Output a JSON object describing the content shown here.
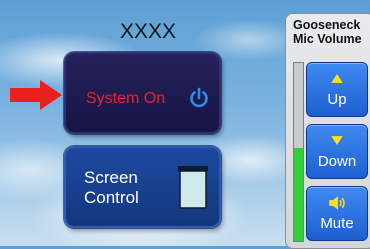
{
  "header": {
    "title": "XXXX"
  },
  "indicator": {
    "icon": "red-arrow-icon",
    "color": "#e8201e"
  },
  "tiles": {
    "system_on": {
      "label": "System On",
      "icon": "power-icon",
      "label_color": "#e8252d",
      "icon_color": "#2f8ce6"
    },
    "screen_control": {
      "label_line1": "Screen",
      "label_line2": "Control",
      "icon": "projector-screen-icon"
    }
  },
  "volume_panel": {
    "title_line1": "Gooseneck",
    "title_line2": "Mic Volume",
    "level": 0.52,
    "meter_color": "#34d03a",
    "buttons": {
      "up": {
        "label": "Up",
        "icon": "triangle-up-icon"
      },
      "down": {
        "label": "Down",
        "icon": "triangle-down-icon"
      },
      "mute": {
        "label": "Mute",
        "icon": "speaker-icon"
      }
    }
  }
}
